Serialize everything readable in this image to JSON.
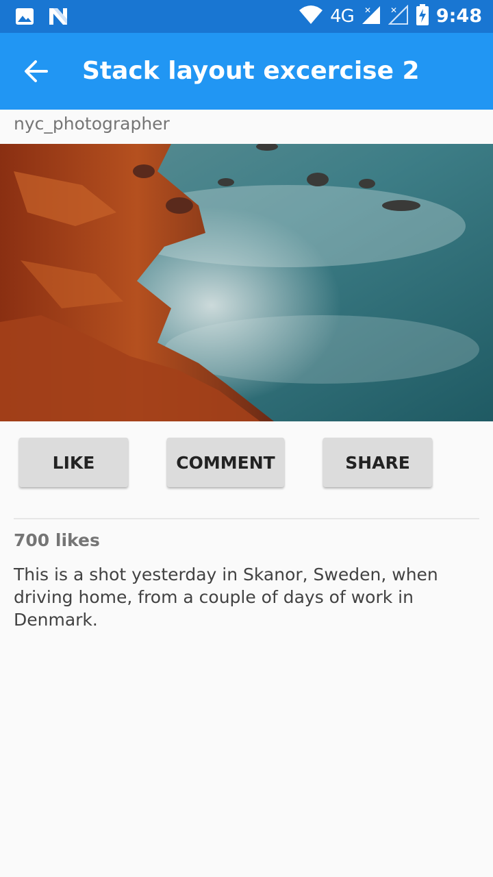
{
  "status_bar": {
    "time": "9:48",
    "network": "4G",
    "icons": [
      "gallery-icon",
      "n-notification-icon",
      "wifi-icon",
      "signal-icon",
      "signal-empty-icon",
      "battery-charging-icon"
    ]
  },
  "app_bar": {
    "title": "Stack layout excercise 2",
    "back_icon": "arrow-back-icon"
  },
  "post": {
    "username": "nyc_photographer",
    "image_alt": "Rocky coastline with misty long-exposure sea",
    "buttons": {
      "like": "LIKE",
      "comment": "COMMENT",
      "share": "SHARE"
    },
    "likes": "700 likes",
    "caption": "This is a shot yesterday in Skanor, Sweden, when driving home, from a couple of days of work in Denmark."
  },
  "colors": {
    "status_bar": "#1976d2",
    "app_bar": "#2196f3",
    "background": "#fafafa",
    "button": "#dcdcdc"
  }
}
